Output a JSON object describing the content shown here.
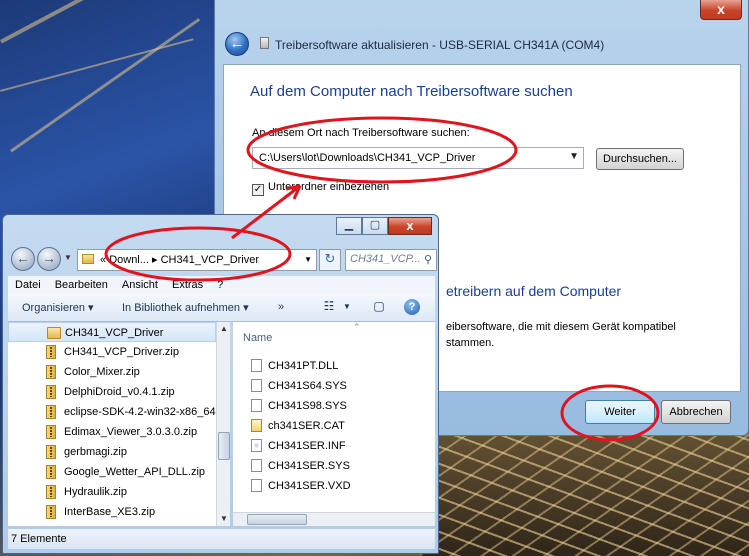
{
  "wizard": {
    "close_glyph": "x",
    "back_glyph": "←",
    "title": "Treibersoftware aktualisieren - USB-SERIAL CH341A (COM4)",
    "heading": "Auf dem Computer nach Treibersoftware suchen",
    "search_label": "An diesem Ort nach Treibersoftware suchen:",
    "path_value": "C:\\Users\\lot\\Downloads\\CH341_VCP_Driver",
    "browse_label": "Durchsuchen...",
    "subfolder_label": "Unterordner einbeziehen",
    "subfolder_checked": "✓",
    "heading2": "etreibern auf dem Computer",
    "desc_line1": "eibersoftware, die mit diesem Gerät kompatibel",
    "desc_line2": "stammen.",
    "next_label": "Weiter",
    "cancel_label": "Abbrechen"
  },
  "explorer": {
    "controls": {
      "minimize": "▁",
      "maximize": "▢",
      "close": "x"
    },
    "address": {
      "prefix": "«",
      "segment1": "Downl...",
      "separator": "▸",
      "segment2": "CH341_VCP_Driver"
    },
    "search_placeholder": "CH341_VCP...",
    "menu": [
      "Datei",
      "Bearbeiten",
      "Ansicht",
      "Extras",
      "?"
    ],
    "toolbar": {
      "organize": "Organisieren ▾",
      "library": "In Bibliothek aufnehmen ▾",
      "more": "»"
    },
    "nav_items": [
      {
        "label": "CH341_VCP_Driver",
        "kind": "folder"
      },
      {
        "label": "CH341_VCP_Driver.zip",
        "kind": "zip"
      },
      {
        "label": "Color_Mixer.zip",
        "kind": "zip"
      },
      {
        "label": "DelphiDroid_v0.4.1.zip",
        "kind": "zip"
      },
      {
        "label": "eclipse-SDK-4.2-win32-x86_64.",
        "kind": "zip"
      },
      {
        "label": "Edimax_Viewer_3.0.3.0.zip",
        "kind": "zip"
      },
      {
        "label": "gerbmagi.zip",
        "kind": "zip"
      },
      {
        "label": "Google_Wetter_API_DLL.zip",
        "kind": "zip"
      },
      {
        "label": "Hydraulik.zip",
        "kind": "zip"
      },
      {
        "label": "InterBase_XE3.zip",
        "kind": "zip"
      }
    ],
    "column_name": "Name",
    "files": [
      {
        "label": "CH341PT.DLL",
        "kind": "dll"
      },
      {
        "label": "CH341S64.SYS",
        "kind": "sys"
      },
      {
        "label": "CH341S98.SYS",
        "kind": "sys"
      },
      {
        "label": "ch341SER.CAT",
        "kind": "cat"
      },
      {
        "label": "CH341SER.INF",
        "kind": "inf"
      },
      {
        "label": "CH341SER.SYS",
        "kind": "sys"
      },
      {
        "label": "CH341SER.VXD",
        "kind": "vxd"
      }
    ],
    "status": "7 Elemente"
  },
  "colors": {
    "heading_blue": "#1a3f8f",
    "annotation_red": "#e0141e"
  }
}
